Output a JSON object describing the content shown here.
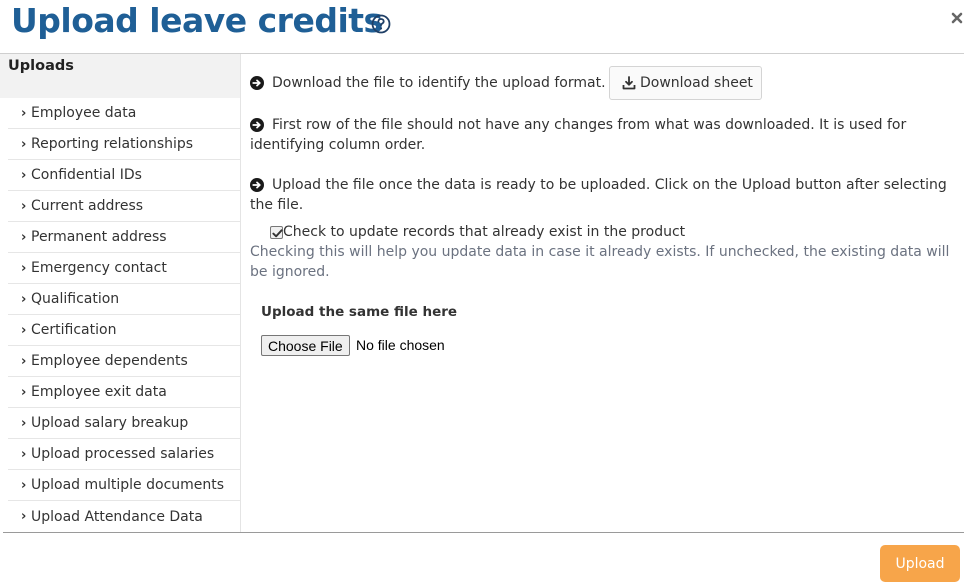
{
  "dialog": {
    "title": "Upload leave credits",
    "help_icon": "help-circle-icon",
    "close_icon": "close-icon"
  },
  "sidebar": {
    "header": "Uploads",
    "chevron_icon": "chevron-right-icon",
    "items": [
      {
        "label": "Employee data"
      },
      {
        "label": "Reporting relationships"
      },
      {
        "label": "Confidential IDs"
      },
      {
        "label": "Current address"
      },
      {
        "label": "Permanent address"
      },
      {
        "label": "Emergency contact"
      },
      {
        "label": "Qualification"
      },
      {
        "label": "Certification"
      },
      {
        "label": "Employee dependents"
      },
      {
        "label": "Employee exit data"
      },
      {
        "label": "Upload salary breakup"
      },
      {
        "label": "Upload processed salaries"
      },
      {
        "label": "Upload multiple documents"
      },
      {
        "label": "Upload Attendance Data"
      }
    ]
  },
  "main": {
    "step_icon": "arrow-circle-right-icon",
    "step1": "Download the file to identify the upload format.",
    "download_button": "Download sheet",
    "download_icon": "download-icon",
    "step2": "First row of the file should not have any changes from what was downloaded. It is used for identifying column order.",
    "step3": "Upload the file once the data is ready to be uploaded. Click on the Upload button after selecting the file.",
    "update_checkbox": {
      "label": "Check to update records that already exist in the product",
      "checked": true
    },
    "update_hint": "Checking this will help you update data in case it already exists. If unchecked, the existing data will be ignored.",
    "upload_label": "Upload the same file here",
    "file_button": "Choose File",
    "file_status": "No file chosen"
  },
  "footer": {
    "upload_button": "Upload"
  },
  "colors": {
    "title": "#1f5f96",
    "upload_button": "#f7a54a",
    "hint_text": "#6b7280"
  }
}
